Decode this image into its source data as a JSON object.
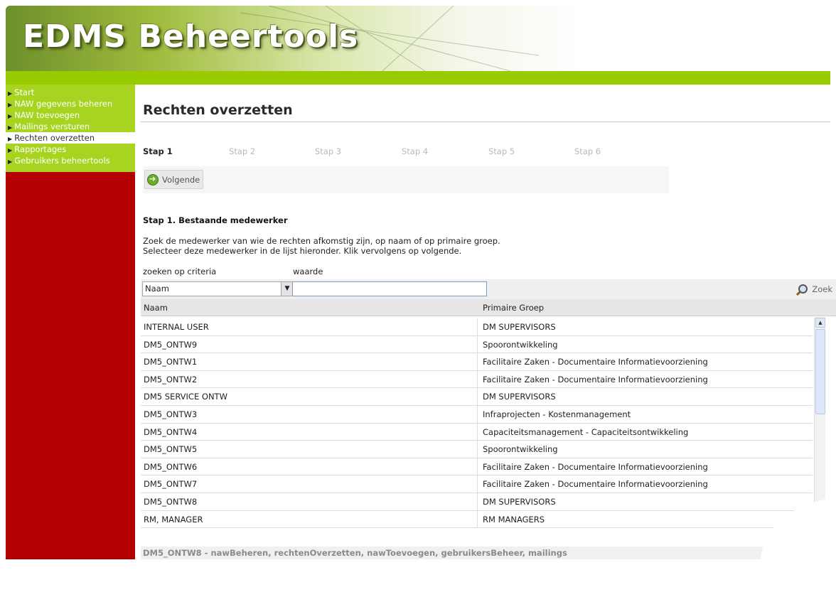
{
  "app": {
    "title": "EDMS Beheertools"
  },
  "sidebar": {
    "items": [
      {
        "label": "Start",
        "active": false
      },
      {
        "label": "NAW gegevens beheren",
        "active": false
      },
      {
        "label": "NAW toevoegen",
        "active": false
      },
      {
        "label": "Mailings versturen",
        "active": false
      },
      {
        "label": "Rechten overzetten",
        "active": true
      },
      {
        "label": "Rapportages",
        "active": false
      },
      {
        "label": "Gebruikers beheertools",
        "active": false
      }
    ]
  },
  "main": {
    "title": "Rechten overzetten",
    "steps": [
      "Stap 1",
      "Stap 2",
      "Stap 3",
      "Stap 4",
      "Stap 5",
      "Stap 6"
    ],
    "active_step": 0,
    "next_label": "Volgende",
    "section_heading": "Stap 1. Bestaande medewerker",
    "instructions": [
      "Zoek de medewerker van wie de rechten afkomstig zijn, op naam of op primaire groep.",
      "Selecteer deze medewerker in de lijst hieronder. Klik vervolgens op volgende."
    ],
    "search": {
      "criteria_label": "zoeken op criteria",
      "value_label": "waarde",
      "criteria_selected": "Naam",
      "value": "",
      "button_label": "Zoek"
    },
    "table": {
      "columns": [
        "Naam",
        "Primaire Groep"
      ],
      "rows": [
        [
          "INTERNAL USER",
          "DM SUPERVISORS"
        ],
        [
          "DM5_ONTW9",
          "Spoorontwikkeling"
        ],
        [
          "DM5_ONTW1",
          "Facilitaire Zaken - Documentaire Informatievoorziening"
        ],
        [
          "DM5_ONTW2",
          "Facilitaire Zaken - Documentaire Informatievoorziening"
        ],
        [
          "DM5 SERVICE ONTW",
          "DM SUPERVISORS"
        ],
        [
          "DM5_ONTW3",
          "Infraprojecten - Kostenmanagement"
        ],
        [
          "DM5_ONTW4",
          "Capaciteitsmanagement - Capaciteitsontwikkeling"
        ],
        [
          "DM5_ONTW5",
          "Spoorontwikkeling"
        ],
        [
          "DM5_ONTW6",
          "Facilitaire Zaken - Documentaire Informatievoorziening"
        ],
        [
          "DM5_ONTW7",
          "Facilitaire Zaken - Documentaire Informatievoorziening"
        ],
        [
          "DM5_ONTW8",
          "DM SUPERVISORS"
        ],
        [
          "RM, MANAGER",
          "RM MANAGERS"
        ]
      ]
    },
    "status": "DM5_ONTW8 - nawBeheren, rechtenOverzetten, nawToevoegen, gebruikersBeheer, mailings"
  },
  "colors": {
    "accent_green": "#99cc00",
    "sidebar_red": "#b40000",
    "nav_green": "#a8d320"
  }
}
